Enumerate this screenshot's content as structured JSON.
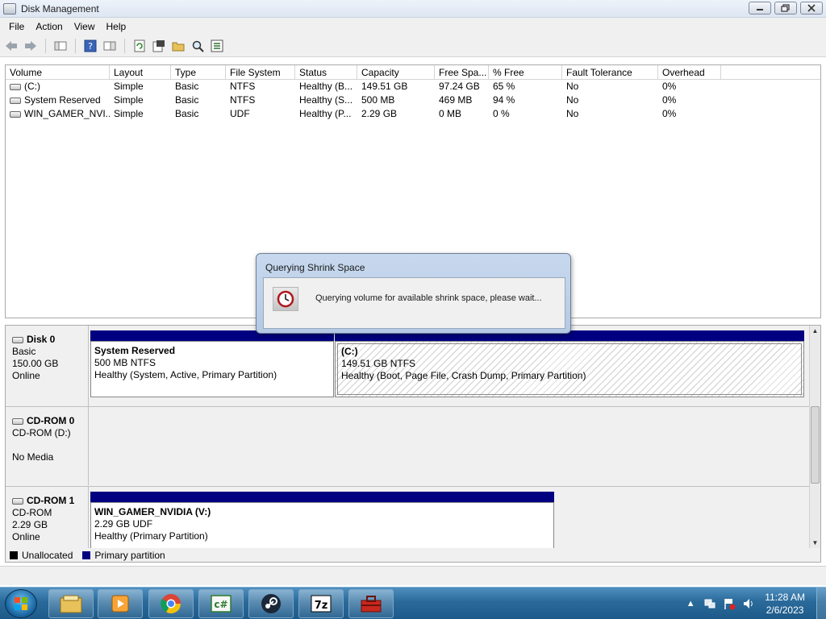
{
  "window": {
    "title": "Disk Management",
    "minimize_icon": "minimize-icon",
    "restore_icon": "restore-icon",
    "close_icon": "close-icon"
  },
  "menu": [
    "File",
    "Action",
    "View",
    "Help"
  ],
  "toolbar": {
    "icons": [
      "back-icon",
      "forward-icon",
      "console-tree-icon",
      "help-icon",
      "show-hide-icon",
      "refresh-icon",
      "properties-icon",
      "open-icon",
      "search-icon",
      "options-icon"
    ]
  },
  "volume_list": {
    "headers": [
      "Volume",
      "Layout",
      "Type",
      "File System",
      "Status",
      "Capacity",
      "Free Spa...",
      "% Free",
      "Fault Tolerance",
      "Overhead"
    ],
    "rows": [
      [
        "(C:)",
        "Simple",
        "Basic",
        "NTFS",
        "Healthy (B...",
        "149.51 GB",
        "97.24 GB",
        "65 %",
        "No",
        "0%"
      ],
      [
        "System Reserved",
        "Simple",
        "Basic",
        "NTFS",
        "Healthy (S...",
        "500 MB",
        "469 MB",
        "94 %",
        "No",
        "0%"
      ],
      [
        "WIN_GAMER_NVI...",
        "Simple",
        "Basic",
        "UDF",
        "Healthy (P...",
        "2.29 GB",
        "0 MB",
        "0 %",
        "No",
        "0%"
      ]
    ]
  },
  "disks": {
    "disk0": {
      "name": "Disk 0",
      "type": "Basic",
      "size": "150.00 GB",
      "state": "Online",
      "partitions": [
        {
          "name": "System Reserved",
          "size": "500 MB NTFS",
          "status": "Healthy (System, Active, Primary Partition)"
        },
        {
          "name": "(C:)",
          "size": "149.51 GB NTFS",
          "status": "Healthy (Boot, Page File, Crash Dump, Primary Partition)"
        }
      ]
    },
    "cdrom0": {
      "name": "CD-ROM 0",
      "type": "CD-ROM (D:)",
      "state": "No Media"
    },
    "cdrom1": {
      "name": "CD-ROM 1",
      "type": "CD-ROM",
      "size": "2.29 GB",
      "state": "Online",
      "partitions": [
        {
          "name": "WIN_GAMER_NVIDIA  (V:)",
          "size": "2.29 GB UDF",
          "status": "Healthy (Primary Partition)"
        }
      ]
    }
  },
  "legend": [
    {
      "label": "Unallocated",
      "color": "#000000"
    },
    {
      "label": "Primary partition",
      "color": "#000080"
    }
  ],
  "dialog": {
    "title": "Querying Shrink Space",
    "message": "Querying volume for available shrink space, please wait..."
  },
  "taskbar": {
    "apps": [
      "file-explorer-icon",
      "media-player-icon",
      "chrome-icon",
      "csharp-icon",
      "steam-icon",
      "7zip-icon",
      "toolbox-icon"
    ],
    "time": "11:28 AM",
    "date": "2/6/2023"
  },
  "colors": {
    "partition_bar": "#000080",
    "taskbar": "#2a6a9a"
  }
}
